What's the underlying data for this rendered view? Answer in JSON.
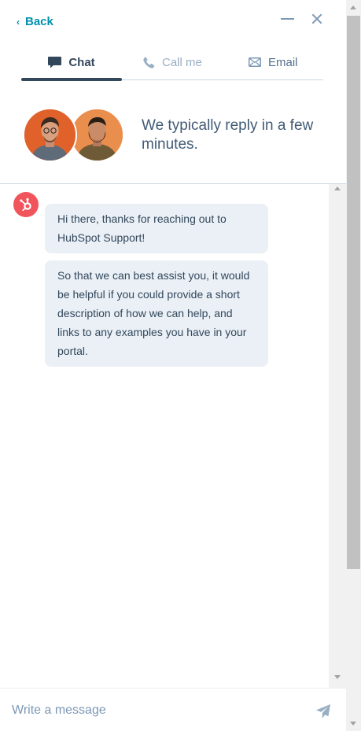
{
  "header": {
    "back_label": "Back",
    "back_chevron": "‹"
  },
  "tabs": [
    {
      "label": "Chat",
      "icon": "chat-bubble-icon",
      "active": true
    },
    {
      "label": "Call me",
      "icon": "phone-icon",
      "active": false
    },
    {
      "label": "Email",
      "icon": "envelope-icon",
      "active": false
    }
  ],
  "team": {
    "reply_text": "We typically reply in a few minutes."
  },
  "messages": [
    {
      "sender": "bot",
      "text": "Hi there, thanks for reaching out to HubSpot Support!"
    },
    {
      "sender": "bot",
      "text": "So that we can best assist you, it would be helpful if you could provide a short description of how we can help, and links to any examples you have in your portal."
    }
  ],
  "composer": {
    "placeholder": "Write a message",
    "value": ""
  },
  "colors": {
    "accent": "#0091ae",
    "brand": "#f2545b",
    "text": "#33475b",
    "bubble": "#eaf0f6",
    "muted": "#7c98b6"
  }
}
